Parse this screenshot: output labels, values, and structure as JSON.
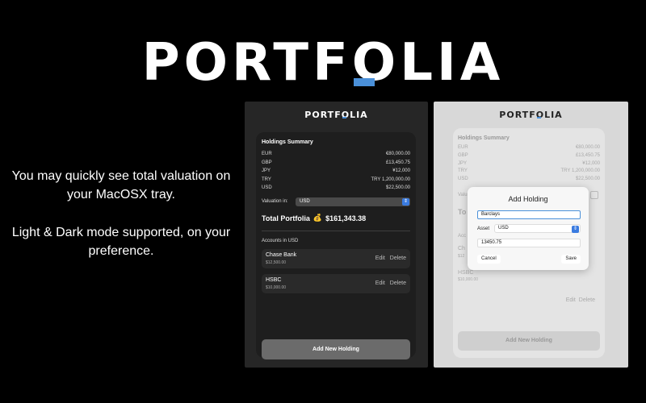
{
  "brand": {
    "title_main": "PORTF",
    "title_accent": "O",
    "title_tail": "LIA",
    "accent_color": "#4a90d9"
  },
  "promo": {
    "line1": "You may quickly see total valuation on your MacOSX tray.",
    "line2": "Light & Dark mode supported, on your preference."
  },
  "dark_window": {
    "summary_title": "Holdings Summary",
    "holdings": [
      {
        "currency": "EUR",
        "amount": "€80,000.00"
      },
      {
        "currency": "GBP",
        "amount": "£13,450.75"
      },
      {
        "currency": "JPY",
        "amount": "¥12,000"
      },
      {
        "currency": "TRY",
        "amount": "TRY 1,200,000.00"
      },
      {
        "currency": "USD",
        "amount": "$22,500.00"
      }
    ],
    "valuation_label": "Valuation in:",
    "valuation_currency": "USD",
    "total_label": "Total Portfolia",
    "total_icon": "💰",
    "total_value": "$161,343.38",
    "accounts_title": "Accounts in USD",
    "accounts": [
      {
        "name": "Chase Bank",
        "amount": "$12,500.00",
        "edit": "Edit",
        "delete": "Delete"
      },
      {
        "name": "HSBC",
        "amount": "$10,000.00",
        "edit": "Edit",
        "delete": "Delete"
      }
    ],
    "add_button": "Add New Holding"
  },
  "light_window": {
    "summary_title": "Holdings Summary",
    "holdings": [
      {
        "currency": "EUR",
        "amount": "€80,000.00"
      },
      {
        "currency": "GBP",
        "amount": "£13,450.75"
      },
      {
        "currency": "JPY",
        "amount": "¥12,000"
      },
      {
        "currency": "TRY",
        "amount": "TRY 1,200,000.00"
      },
      {
        "currency": "USD",
        "amount": "$22,500.00"
      }
    ],
    "val_frag": "Valu",
    "total_frag": "To",
    "acc_frag": "Acc",
    "acc1_frag": "Ch",
    "acc1_amt_frag": "$12",
    "acc2_frag": "HSBC",
    "acc2_amt_frag": "$10,000.00",
    "edit": "Edit",
    "delete": "Delete",
    "add_button": "Add New Holding",
    "modal": {
      "title": "Add Holding",
      "name_value": "Barclays",
      "asset_label": "Asset",
      "asset_value": "USD",
      "amount_value": "13450.75",
      "cancel": "Cancel",
      "save": "Save"
    }
  }
}
